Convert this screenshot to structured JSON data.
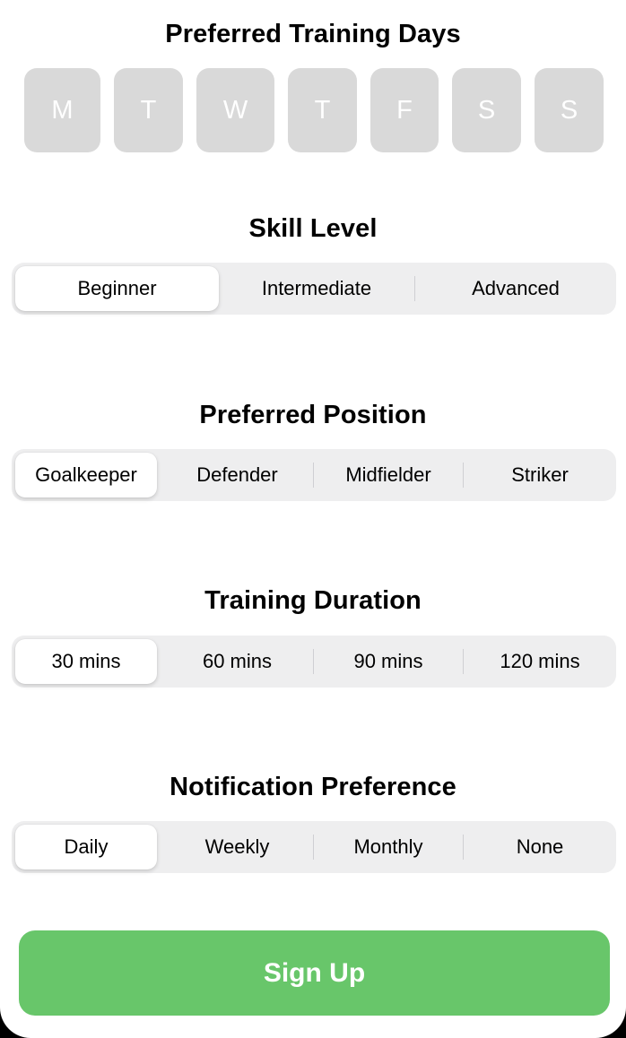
{
  "training_days": {
    "title": "Preferred Training Days",
    "days": [
      "M",
      "T",
      "W",
      "T",
      "F",
      "S",
      "S"
    ]
  },
  "skill_level": {
    "title": "Skill Level",
    "options": [
      "Beginner",
      "Intermediate",
      "Advanced"
    ],
    "selected": "Beginner"
  },
  "preferred_position": {
    "title": "Preferred Position",
    "options": [
      "Goalkeeper",
      "Defender",
      "Midfielder",
      "Striker"
    ],
    "selected": "Goalkeeper"
  },
  "training_duration": {
    "title": "Training Duration",
    "options": [
      "30 mins",
      "60 mins",
      "90 mins",
      "120 mins"
    ],
    "selected": "30 mins"
  },
  "notification_preference": {
    "title": "Notification Preference",
    "options": [
      "Daily",
      "Weekly",
      "Monthly",
      "None"
    ],
    "selected": "Daily"
  },
  "submit": {
    "label": "Sign Up"
  },
  "colors": {
    "day_pill_unselected": "#d9d9d9",
    "segment_track": "#eeeeef",
    "segment_selected": "#ffffff",
    "primary_button": "#68c66a"
  }
}
